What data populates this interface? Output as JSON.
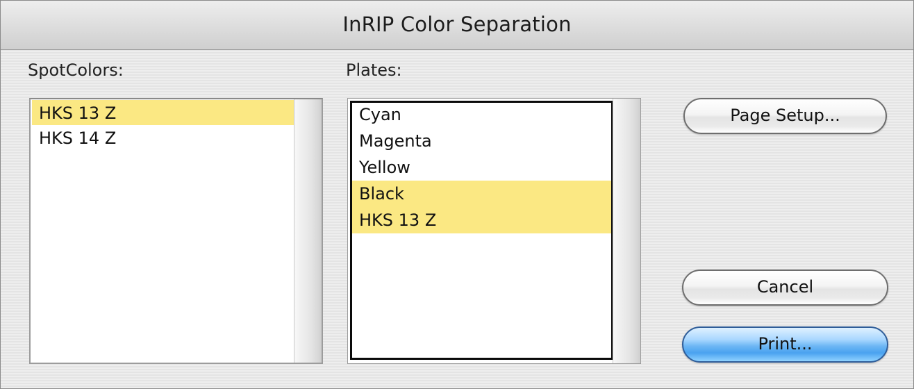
{
  "window": {
    "title": "InRIP Color Separation"
  },
  "spot_colors": {
    "label": "SpotColors:",
    "items": [
      {
        "label": "HKS 13 Z",
        "selected": true
      },
      {
        "label": "HKS 14 Z",
        "selected": false
      }
    ]
  },
  "plates": {
    "label": "Plates:",
    "items": [
      {
        "label": "Cyan",
        "selected": false
      },
      {
        "label": "Magenta",
        "selected": false
      },
      {
        "label": "Yellow",
        "selected": false
      },
      {
        "label": "Black",
        "selected": true
      },
      {
        "label": "HKS 13 Z",
        "selected": true
      }
    ]
  },
  "buttons": {
    "page_setup": "Page Setup...",
    "cancel": "Cancel",
    "print": "Print..."
  },
  "colors": {
    "selection_highlight": "#fbe883",
    "default_button": "#5aaaf2"
  }
}
